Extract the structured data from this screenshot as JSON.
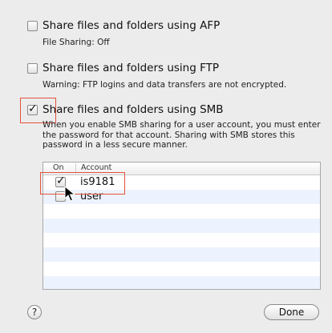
{
  "options": [
    {
      "label": "Share files and folders using AFP",
      "checked": false,
      "note": "File Sharing: Off"
    },
    {
      "label": "Share files and folders using FTP",
      "checked": false,
      "note": "Warning: FTP logins and data transfers are not encrypted."
    },
    {
      "label": "Share files and folders using SMB",
      "checked": true,
      "note": "When you enable SMB sharing for a user account, you must enter the password for that account. Sharing with SMB stores this password in a less secure manner."
    }
  ],
  "accounts_table": {
    "columns": {
      "on": "On",
      "account": "Account"
    },
    "rows": [
      {
        "on": true,
        "account": "is9181"
      },
      {
        "on": false,
        "account": "user"
      }
    ]
  },
  "help_label": "?",
  "done_label": "Done",
  "colors": {
    "highlight": "#e2523b",
    "row_alt": "#edf3fe"
  }
}
